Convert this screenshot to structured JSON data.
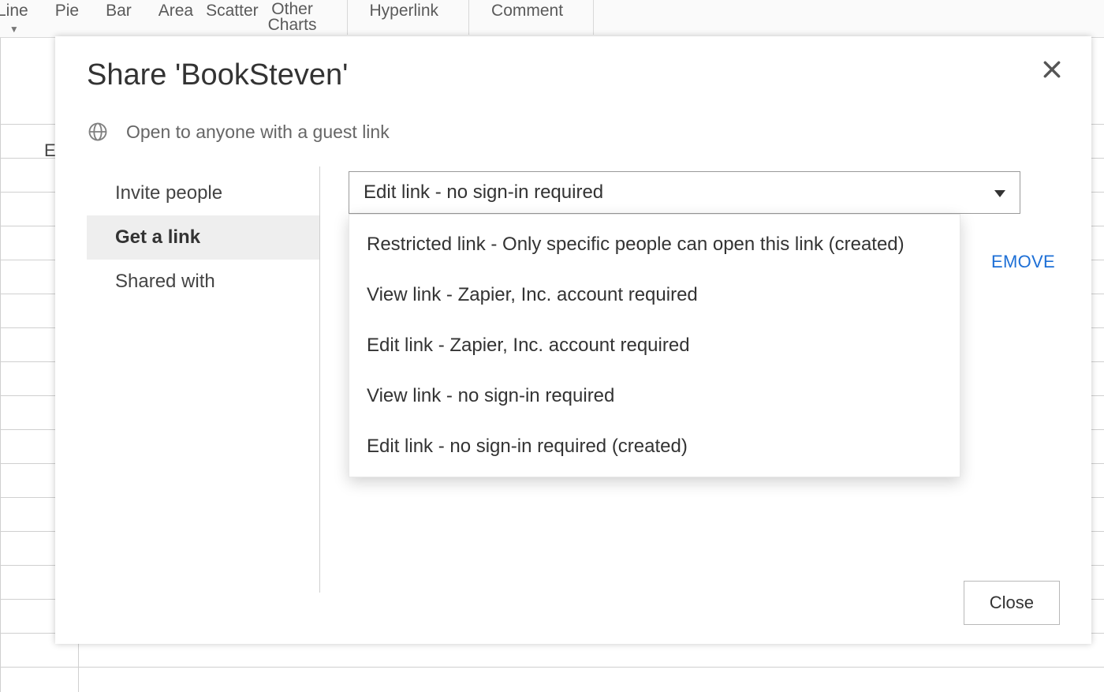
{
  "ribbon": {
    "items": [
      "Line",
      "Pie",
      "Bar",
      "Area",
      "Scatter",
      "Other Charts",
      "Hyperlink",
      "Comment"
    ]
  },
  "sheet": {
    "column_letter": "E"
  },
  "dialog": {
    "title": "Share 'BookSteven'",
    "info": "Open to anyone with a guest link",
    "sidenav": {
      "items": [
        {
          "label": "Invite people"
        },
        {
          "label": "Get a link",
          "active": true
        },
        {
          "label": "Shared with"
        }
      ]
    },
    "dropdown": {
      "selected": "Edit link - no sign-in required",
      "options": [
        "Restricted link - Only specific people can open this link (created)",
        "View link - Zapier, Inc. account required",
        "Edit link - Zapier, Inc. account required",
        "View link - no sign-in required",
        "Edit link - no sign-in required (created)"
      ]
    },
    "remove_label_fragment": "EMOVE",
    "close_button": "Close"
  }
}
